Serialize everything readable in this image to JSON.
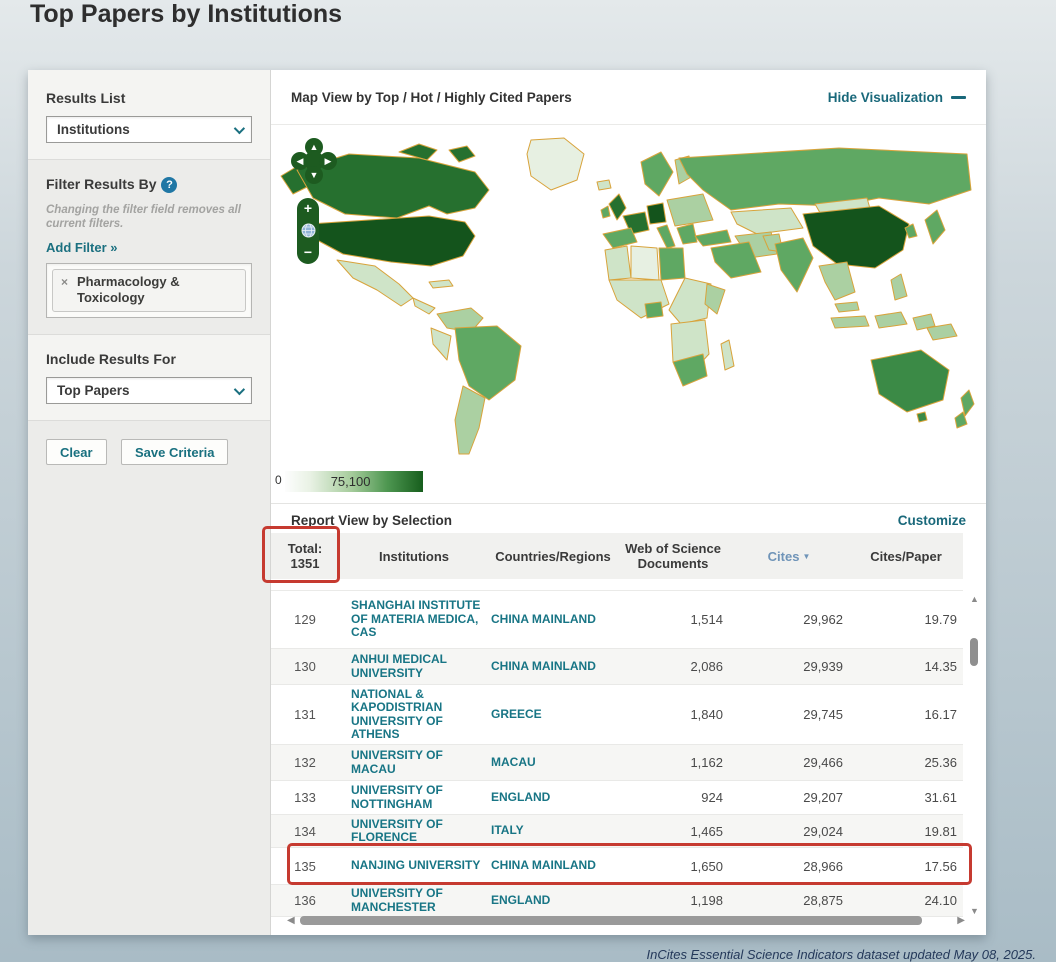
{
  "page": {
    "title": "Top Papers by Institutions",
    "footer": "InCites Essential Science Indicators dataset updated May 08, 2025."
  },
  "sidebar": {
    "results_list": {
      "label": "Results List",
      "value": "Institutions"
    },
    "filter": {
      "heading": "Filter Results By",
      "help_glyph": "?",
      "note": "Changing the filter field removes all current filters.",
      "add_filter_label": "Add Filter »",
      "chip": {
        "remove_glyph": "×",
        "label": "Pharmacology & Toxicology"
      }
    },
    "include": {
      "heading": "Include Results For",
      "value": "Top Papers"
    },
    "buttons": {
      "clear": "Clear",
      "save": "Save Criteria"
    }
  },
  "map_panel": {
    "title": "Map View by Top / Hot / Highly Cited Papers",
    "hide_link": "Hide Visualization",
    "legend": {
      "min": "0",
      "max": "75,100"
    },
    "controls": {
      "pan_up": "▲",
      "pan_down": "▼",
      "pan_left": "◀",
      "pan_right": "▶",
      "zoom_in": "+",
      "zoom_out": "−",
      "globe": "globe-icon"
    }
  },
  "report_panel": {
    "title": "Report View by Selection",
    "customize_link": "Customize",
    "table": {
      "total_label": "Total:",
      "total_value": "1351",
      "columns": [
        "Institutions",
        "Countries/Regions",
        "Web of Science Documents",
        "Cites",
        "Cites/Paper"
      ],
      "sort_glyph": "▼",
      "sorted_column": "Cites",
      "highlighted_rank": "135",
      "rows": [
        {
          "rank": "129",
          "institution": "SHANGHAI INSTITUTE OF MATERIA MEDICA, CAS",
          "country": "CHINA MAINLAND",
          "docs": "1,514",
          "cites": "29,962",
          "cites_per_paper": "19.79"
        },
        {
          "rank": "130",
          "institution": "ANHUI MEDICAL UNIVERSITY",
          "country": "CHINA MAINLAND",
          "docs": "2,086",
          "cites": "29,939",
          "cites_per_paper": "14.35"
        },
        {
          "rank": "131",
          "institution": "NATIONAL & KAPODISTRIAN UNIVERSITY OF ATHENS",
          "country": "GREECE",
          "docs": "1,840",
          "cites": "29,745",
          "cites_per_paper": "16.17"
        },
        {
          "rank": "132",
          "institution": "UNIVERSITY OF MACAU",
          "country": "MACAU",
          "docs": "1,162",
          "cites": "29,466",
          "cites_per_paper": "25.36"
        },
        {
          "rank": "133",
          "institution": "UNIVERSITY OF NOTTINGHAM",
          "country": "ENGLAND",
          "docs": "924",
          "cites": "29,207",
          "cites_per_paper": "31.61"
        },
        {
          "rank": "134",
          "institution": "UNIVERSITY OF FLORENCE",
          "country": "ITALY",
          "docs": "1,465",
          "cites": "29,024",
          "cites_per_paper": "19.81"
        },
        {
          "rank": "135",
          "institution": "NANJING UNIVERSITY",
          "country": "CHINA MAINLAND",
          "docs": "1,650",
          "cites": "28,966",
          "cites_per_paper": "17.56"
        },
        {
          "rank": "136",
          "institution": "UNIVERSITY OF MANCHESTER",
          "country": "ENGLAND",
          "docs": "1,198",
          "cites": "28,875",
          "cites_per_paper": "24.10"
        }
      ]
    }
  },
  "colors": {
    "accent_teal": "#19707f",
    "annotation_red": "#c63a30",
    "sort_blue": "#6f94b8",
    "map_border_orange": "#d8a33b",
    "map_darkest_green": "#14541c",
    "map_palest_green": "#e7f0e2"
  }
}
